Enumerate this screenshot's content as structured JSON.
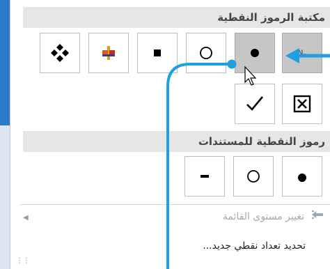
{
  "gallery": {
    "library_header": "مكتبة الرموز النقطية",
    "document_header": "رموز النقطية للمستندات",
    "library_bullets": [
      {
        "name": "none",
        "label": "بلا",
        "selected": true
      },
      {
        "name": "filled-circle",
        "selected": true
      },
      {
        "name": "hollow-circle"
      },
      {
        "name": "filled-square"
      },
      {
        "name": "colored-cross"
      },
      {
        "name": "four-diamonds"
      },
      {
        "name": "boxed-x"
      },
      {
        "name": "checkmark"
      }
    ],
    "document_bullets": [
      {
        "name": "filled-circle"
      },
      {
        "name": "hollow-circle"
      },
      {
        "name": "dash"
      }
    ]
  },
  "menu": {
    "change_list_level": "تغيير مستوى القائمة",
    "define_new_bullet": "تحديد تعداد نقطي جديد..."
  },
  "colors": {
    "annotation_blue": "#1ba1e2",
    "selected_tile": "#c6c6c6",
    "header_bg": "#e6e6e6"
  }
}
